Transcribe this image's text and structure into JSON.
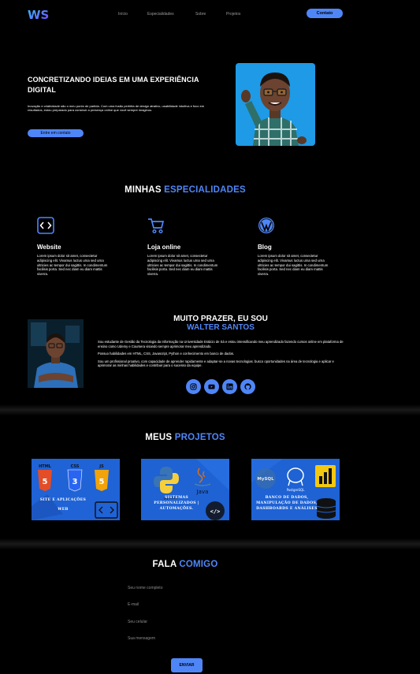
{
  "nav": {
    "logo_text": "WS",
    "links": [
      "Início",
      "Especialidades",
      "Sobre",
      "Projetos"
    ],
    "cta": "Contato"
  },
  "hero": {
    "title": "CONCRETIZANDO IDEIAS EM UMA EXPERIÊNCIA DIGITAL",
    "text": "Inovação e criatividade são o meu ponto de partida. Com uma fusão perfeita de design atrativo, usabilidade intuitiva e foco em resultados, estou preparado para construir a presença online que você sempre imaginou.",
    "cta": "Entre em contato"
  },
  "specialties": {
    "title_a": "MINHAS",
    "title_b": "ESPECIALIDADES",
    "cards": [
      {
        "icon": "code-icon",
        "title": "Website",
        "text": "Lorem ipsum dolor sit amet, consectetur adipiscing elit. Vivamus luctus urna sed urna ultricies ac tempor dui sagittis. In condimentum facilisis porta. Sed nec diam eu diam mattis viverra."
      },
      {
        "icon": "shopping-cart-icon",
        "title": "Loja online",
        "text": "Lorem ipsum dolor sit amet, consectetur adipiscing elit. Vivamus luctus urna sed urna ultricies ac tempor dui sagittis. In condimentum facilisis porta. Sed nec diam eu diam mattis viverra."
      },
      {
        "icon": "wordpress-icon",
        "title": "Blog",
        "text": "Lorem ipsum dolor sit amet, consectetur adipiscing elit. Vivamus luctus urna sed urna ultricies ac tempor dui sagittis. In condimentum facilisis porta. Sed nec diam eu diam mattis viverra."
      }
    ]
  },
  "about": {
    "title_line1": "MUITO PRAZER, EU SOU",
    "title_line2": "WALTER SANTOS",
    "p1": "Sou estudante de Gestão da Tecnologia da Informação na Universidade Estácio de Sá e estou intensificando meu aprendizado fazendo cursos online em plataforma de ensino como Udemy e Coursera visando sempre aprimorar meu aprendizado.",
    "p2": "Possuo habilidades em HTML, CSS, Javascript, Python e conhecimento em banco de dados.",
    "p3": "Sou um profissional proativo, com capacidade de aprender rapidamente e adaptar-se a novas tecnologias. busco oportunidades na área de tecnologia e aplicar e aprimorar as minhas habilidades e contribuir para o sucesso da equipe.",
    "socials": [
      "instagram-icon",
      "youtube-icon",
      "linkedin-icon",
      "github-icon"
    ]
  },
  "projects": {
    "title_a": "MEUS",
    "title_b": "PROJETOS",
    "items": [
      {
        "caption1": "SITE E APLICAÇÕES",
        "caption2": "WEB",
        "badges": [
          "HTML",
          "CSS",
          "JS"
        ]
      },
      {
        "caption1": "SISTEMAS",
        "caption2": "PERSONALIZADOS |",
        "caption3": "AUTOMAÇÕES.",
        "badges": [
          "python",
          "Java"
        ]
      },
      {
        "caption1": "BANCO DE DADOS,",
        "caption2": "MANIPULAÇÃO DE DADOS,",
        "caption3": "DASHBOARDS E ANÁLISES",
        "badges": [
          "MySQL",
          "PostgreSQL"
        ]
      }
    ]
  },
  "contact": {
    "title_a": "FALA",
    "title_b": "COMIGO",
    "name_ph": "Seu nome completo",
    "email_ph": "E-mail",
    "phone_ph": "Seu celular",
    "msg_ph": "Sua mensagem",
    "submit": "ENVIAR"
  },
  "colors": {
    "accent": "#4f86f7",
    "background": "#000000"
  }
}
